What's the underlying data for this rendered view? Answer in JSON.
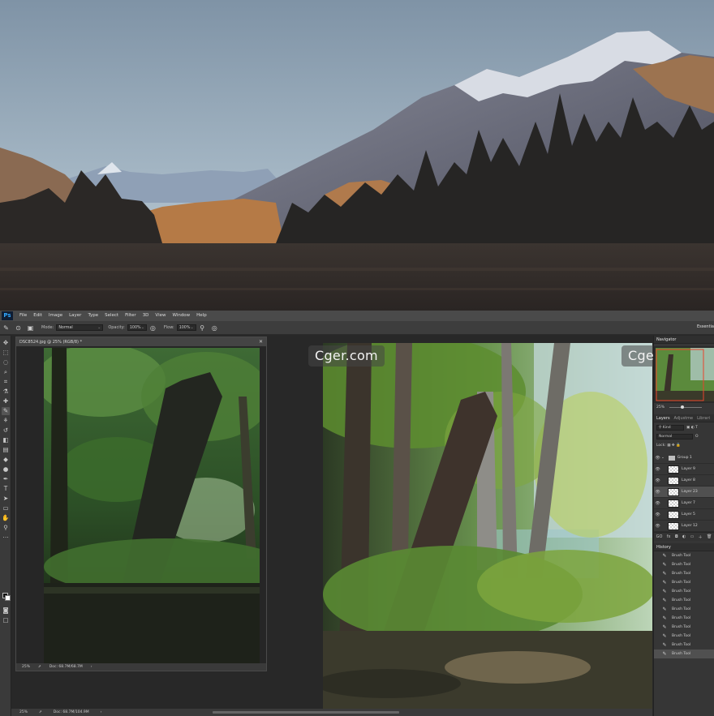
{
  "menubar": {
    "logo": "Ps",
    "items": [
      "File",
      "Edit",
      "Image",
      "Layer",
      "Type",
      "Select",
      "Filter",
      "3D",
      "View",
      "Window",
      "Help"
    ]
  },
  "options": {
    "mode_label": "Mode:",
    "mode_value": "Normal",
    "opacity_label": "Opacity:",
    "opacity_value": "100%",
    "flow_label": "Flow:",
    "flow_value": "100%",
    "workspace": "Essentia"
  },
  "document": {
    "title": "DSC8524.jpg @ 25% (RGB/8) *",
    "zoom": "25%",
    "doc_info": "Doc: 68.7M/68.7M"
  },
  "main": {
    "zoom": "25%",
    "doc_info": "Doc: 68.7M/104.9M"
  },
  "watermarks": [
    "Cger.com",
    "Cger.com"
  ],
  "navigator": {
    "title": "Navigator",
    "zoom": "25%"
  },
  "layers": {
    "tabs": [
      "Layers",
      "Adjustme",
      "Librari"
    ],
    "kind": "Kind",
    "blend": "Normal",
    "opacity_short": "O",
    "lock_label": "Lock:",
    "items": [
      {
        "name": "Group 1",
        "type": "group",
        "selected": false
      },
      {
        "name": "Layer 9",
        "type": "layer",
        "selected": false
      },
      {
        "name": "Layer 8",
        "type": "layer",
        "selected": false
      },
      {
        "name": "Layer 23",
        "type": "layer",
        "selected": true
      },
      {
        "name": "Layer 7",
        "type": "layer",
        "selected": false
      },
      {
        "name": "Layer 5",
        "type": "layer",
        "selected": false
      },
      {
        "name": "Layer 12",
        "type": "layer",
        "selected": false
      }
    ],
    "footer": [
      "GO",
      "fx"
    ]
  },
  "history": {
    "title": "History",
    "items": [
      "Brush Tool",
      "Brush Tool",
      "Brush Tool",
      "Brush Tool",
      "Brush Tool",
      "Brush Tool",
      "Brush Tool",
      "Brush Tool",
      "Brush Tool",
      "Brush Tool",
      "Brush Tool",
      "Brush Tool"
    ]
  },
  "colors": {
    "panel_bg": "#363636",
    "menubar_bg": "#4a4a4a",
    "selected_row": "#505050",
    "ps_blue": "#31a8ff",
    "nav_frame": "#e8432c"
  }
}
